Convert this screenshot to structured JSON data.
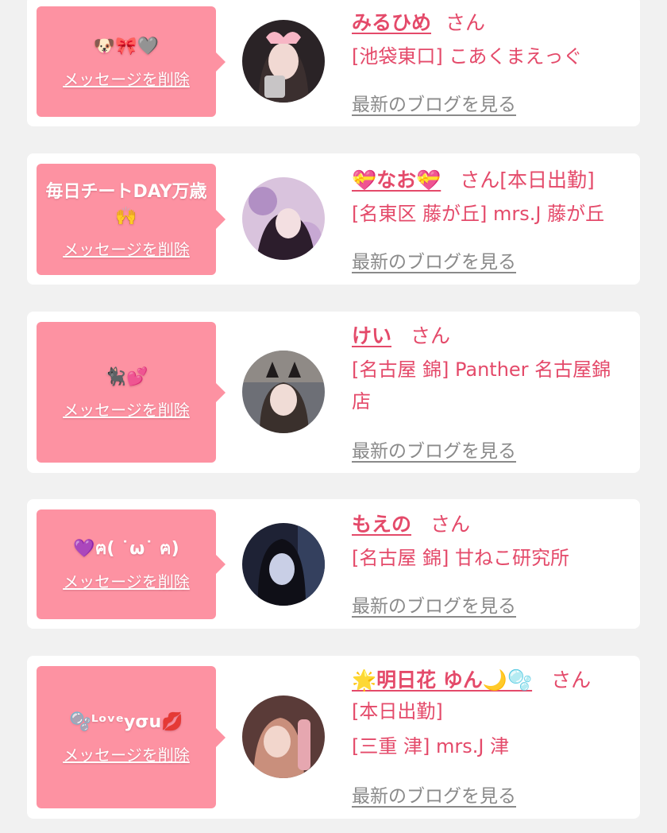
{
  "entries": [
    {
      "bubble_text": "🐶🎀🩶",
      "delete_label": "メッセージを削除",
      "name": "みるひめ",
      "honorific": "さん",
      "tag": "",
      "lines": [
        "[池袋東口] こあくまえっぐ"
      ],
      "blog_label": "最新のブログを見る"
    },
    {
      "bubble_text": "毎日チートDAY万歳🙌",
      "delete_label": "メッセージを削除",
      "name": "💝なお💝",
      "honorific": "さん",
      "tag": "[本日出勤]",
      "lines": [
        "[名東区 藤が丘] mrs.J 藤が丘"
      ],
      "blog_label": "最新のブログを見る"
    },
    {
      "bubble_text": "🐈‍⬛💕",
      "delete_label": "メッセージを削除",
      "name": "けい",
      "honorific": "さん",
      "tag": "",
      "lines": [
        "[名古屋 錦] Panther 名古屋錦",
        "店"
      ],
      "blog_label": "最新のブログを見る"
    },
    {
      "bubble_text": "💜ฅ( ˙ω˙ ฅ)",
      "delete_label": "メッセージを削除",
      "name": "もえの",
      "honorific": "さん",
      "tag": "",
      "lines": [
        "[名古屋 錦] 甘ねこ研究所"
      ],
      "blog_label": "最新のブログを見る"
    },
    {
      "bubble_text": "🫧ᴸᵒᵛᵉyσu💋",
      "delete_label": "メッセージを削除",
      "name": "🌟明日花 ゆん🌙🫧",
      "honorific": "さん",
      "tag": "",
      "lines": [
        "[本日出勤]",
        "[三重 津] mrs.J 津"
      ],
      "blog_label": "最新のブログを見る"
    }
  ],
  "colors": {
    "bubble_bg": "#fd92a2",
    "accent_text": "#e44a6a",
    "link_gray": "#8a8a8a",
    "page_bg": "#f1f1f1"
  }
}
